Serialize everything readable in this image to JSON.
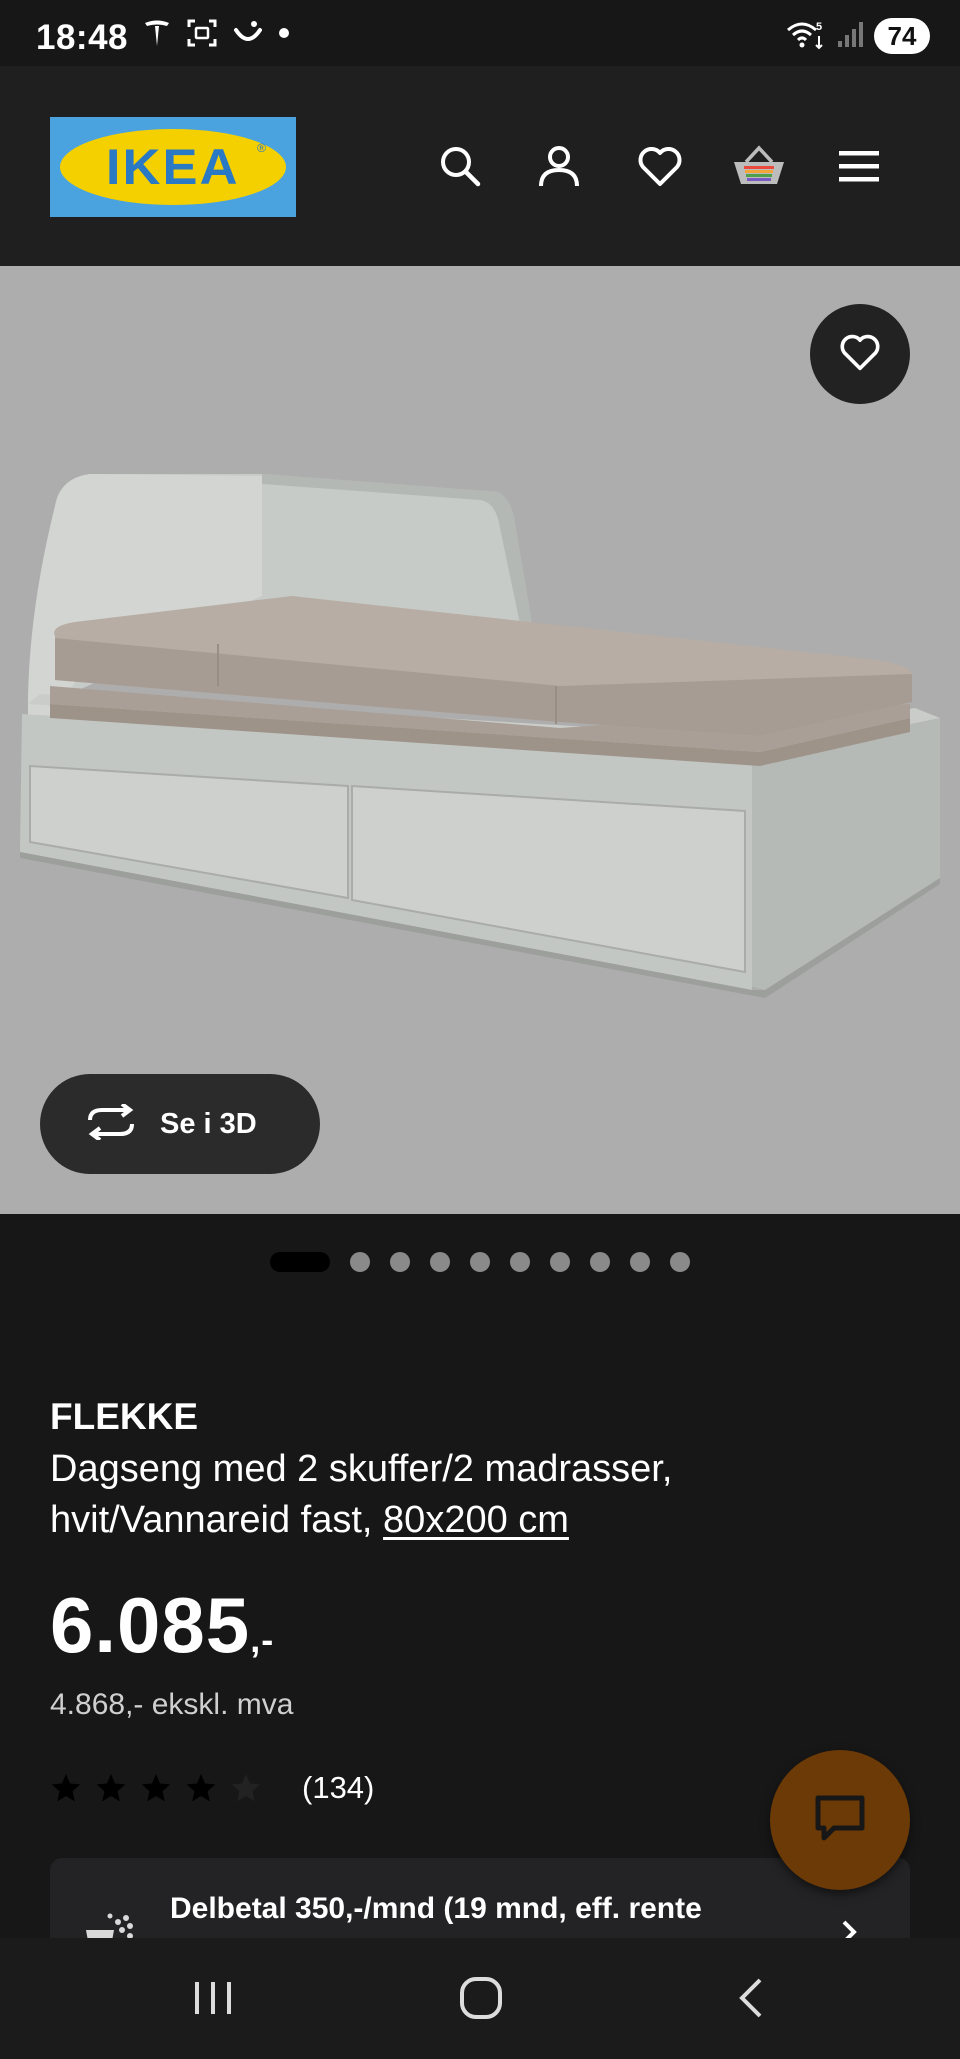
{
  "status_bar": {
    "time": "18:48",
    "battery": "74"
  },
  "header": {
    "logo_text": "IKEA",
    "icons": [
      "search-icon",
      "account-icon",
      "heart-icon",
      "basket-icon",
      "menu-icon"
    ]
  },
  "hero": {
    "view_3d_label": "Se i 3D",
    "image_count": 10,
    "active_image": 1
  },
  "product": {
    "brand": "FLEKKE",
    "description": "Dagseng med 2 skuffer/2 madrasser, hvit/Vannareid fast,",
    "size": "80x200 cm",
    "price_main": "6.085",
    "price_suffix": ",-",
    "price_ex_vat": "4.868,- ekskl. mva",
    "rating": 4,
    "rating_max": 5,
    "review_count": "(134)"
  },
  "installment": {
    "text": "Delbetal 350,-/mnd (19 mnd, eff. rente"
  },
  "colors": {
    "background": "#171718",
    "header": "#1f1f20",
    "hero": "#adadad",
    "ikea_blue": "#4aa3df",
    "ikea_yellow": "#f5d000",
    "chat_button": "#6b3a06"
  }
}
